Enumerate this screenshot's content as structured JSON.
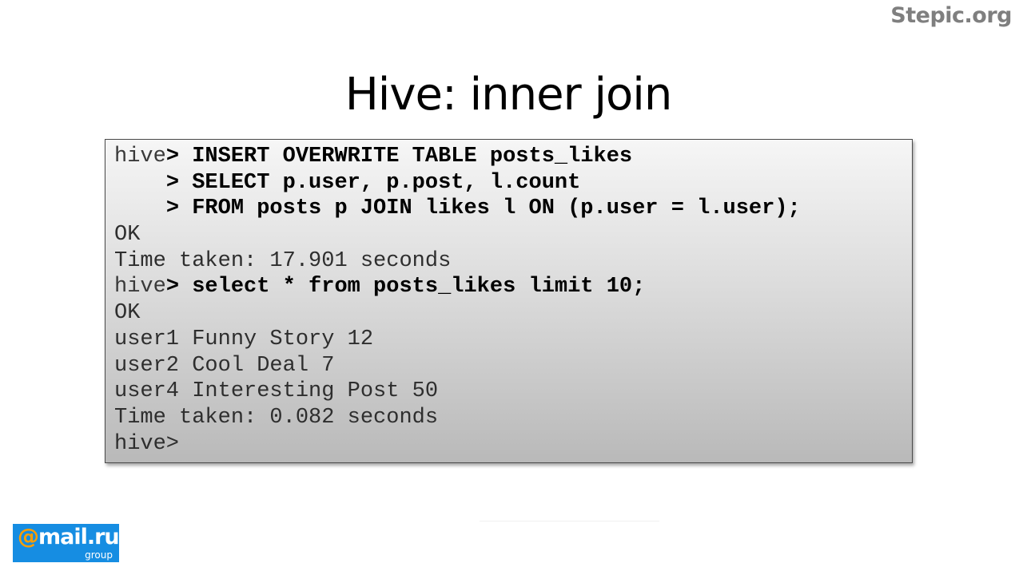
{
  "brand": "Stepic.org",
  "title": "Hive: inner join",
  "console": {
    "lines": [
      {
        "prompt": "hive",
        "command": "> INSERT OVERWRITE TABLE posts_likes"
      },
      {
        "prompt": "    ",
        "command": "> SELECT p.user, p.post, l.count"
      },
      {
        "prompt": "    ",
        "command": "> FROM posts p JOIN likes l ON (p.user = l.user);"
      },
      {
        "output": "OK"
      },
      {
        "output": "Time taken: 17.901 seconds"
      },
      {
        "prompt": "hive",
        "command": "> select * from posts_likes limit 10;"
      },
      {
        "output": "OK"
      },
      {
        "output": "user1 Funny Story 12"
      },
      {
        "output": "user2 Cool Deal 7"
      },
      {
        "output": "user4 Interesting Post 50"
      },
      {
        "output": "Time taken: 0.082 seconds"
      },
      {
        "output": "hive>"
      }
    ]
  },
  "logo": {
    "at": "@",
    "name": "mail.ru",
    "sub": "group",
    "color": "#168de2",
    "accent": "#ff9e00"
  }
}
